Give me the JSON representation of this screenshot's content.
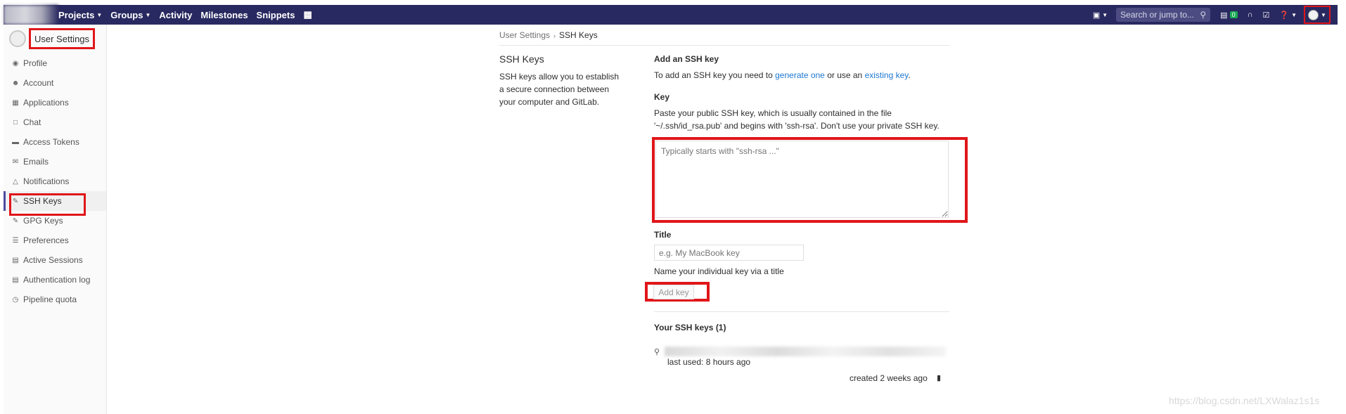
{
  "navbar": {
    "links": [
      "Projects",
      "Groups",
      "Activity",
      "Milestones",
      "Snippets"
    ],
    "search_placeholder": "Search or jump to...",
    "counter": "0"
  },
  "sidebar": {
    "title": "User Settings",
    "items": [
      {
        "label": "Profile",
        "icon": "profile-icon"
      },
      {
        "label": "Account",
        "icon": "account-icon"
      },
      {
        "label": "Applications",
        "icon": "applications-icon"
      },
      {
        "label": "Chat",
        "icon": "chat-icon"
      },
      {
        "label": "Access Tokens",
        "icon": "token-icon"
      },
      {
        "label": "Emails",
        "icon": "email-icon"
      },
      {
        "label": "Notifications",
        "icon": "bell-icon"
      },
      {
        "label": "SSH Keys",
        "icon": "key-icon"
      },
      {
        "label": "GPG Keys",
        "icon": "key-icon"
      },
      {
        "label": "Preferences",
        "icon": "preferences-icon"
      },
      {
        "label": "Active Sessions",
        "icon": "sessions-icon"
      },
      {
        "label": "Authentication log",
        "icon": "log-icon"
      },
      {
        "label": "Pipeline quota",
        "icon": "quota-icon"
      }
    ]
  },
  "breadcrumb": {
    "parent": "User Settings",
    "current": "SSH Keys"
  },
  "section": {
    "title": "SSH Keys",
    "description": "SSH keys allow you to establish a secure connection between your computer and GitLab."
  },
  "form": {
    "heading": "Add an SSH key",
    "intro_prefix": "To add an SSH key you need to ",
    "intro_link1": "generate one",
    "intro_middle": " or use an ",
    "intro_link2": "existing key",
    "intro_suffix": ".",
    "key_label": "Key",
    "key_help_line1": "Paste your public SSH key, which is usually contained in the file",
    "key_help_line2": "'~/.ssh/id_rsa.pub' and begins with 'ssh-rsa'. Don't use your private SSH key.",
    "key_placeholder": "Typically starts with \"ssh-rsa ...\"",
    "title_label": "Title",
    "title_placeholder": "e.g. My MacBook key",
    "title_help": "Name your individual key via a title",
    "add_button": "Add key"
  },
  "keys_list": {
    "heading": "Your SSH keys (1)",
    "items": [
      {
        "last_used": "last used: 8 hours ago",
        "created": "created 2 weeks ago"
      }
    ]
  },
  "watermark": "https://blog.csdn.net/LXWalaz1s1s"
}
